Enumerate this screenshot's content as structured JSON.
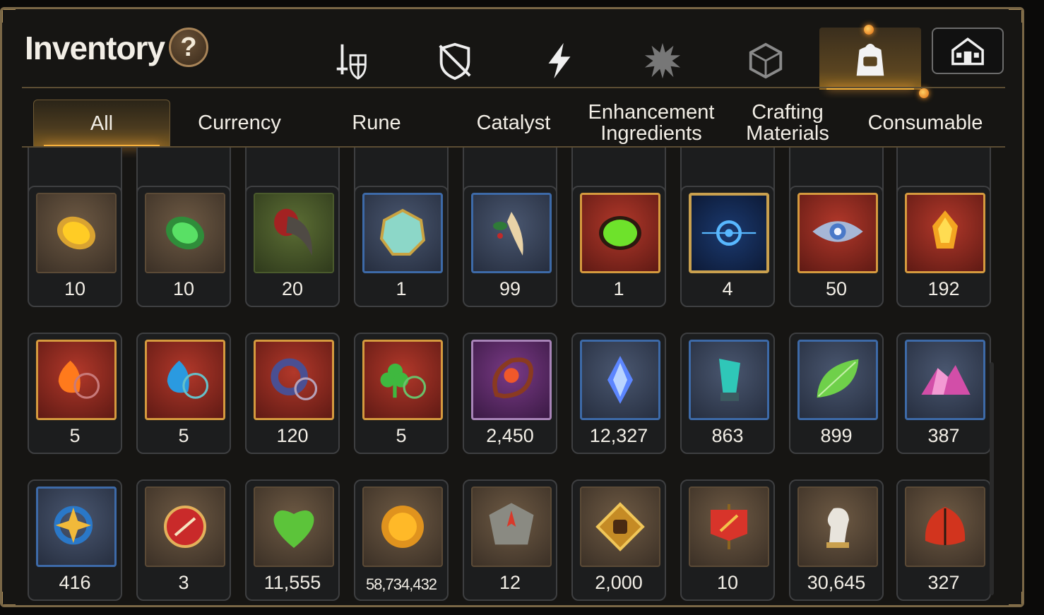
{
  "header": {
    "title": "Inventory",
    "help_label": "?"
  },
  "category_icons": [
    {
      "name": "equipment-icon",
      "active": false
    },
    {
      "name": "broken-shield-icon",
      "active": false
    },
    {
      "name": "lightning-icon",
      "active": false
    },
    {
      "name": "splatter-icon",
      "active": false
    },
    {
      "name": "cube-icon",
      "active": false
    },
    {
      "name": "backpack-icon",
      "active": true
    }
  ],
  "home_button": {
    "icon": "guild-hall-icon"
  },
  "tabs": [
    {
      "label": "All",
      "active": true
    },
    {
      "label": "Currency",
      "active": false
    },
    {
      "label": "Rune",
      "active": false
    },
    {
      "label": "Catalyst",
      "active": false
    },
    {
      "label": "Enhancement\nIngredients",
      "active": false
    },
    {
      "label": "Crafting\nMaterials",
      "active": false
    },
    {
      "label": "Consumable",
      "active": false
    }
  ],
  "rows": [
    [
      {
        "icon": "amber-stone-icon",
        "count": "10"
      },
      {
        "icon": "green-rune-stone-icon",
        "count": "10"
      },
      {
        "icon": "claw-icon",
        "count": "20"
      },
      {
        "icon": "prism-gem-icon",
        "count": "1"
      },
      {
        "icon": "root-herb-icon",
        "count": "99"
      },
      {
        "icon": "green-orb-icon",
        "count": "1"
      },
      {
        "icon": "blue-portal-icon",
        "count": "4"
      },
      {
        "icon": "eye-crest-icon",
        "count": "50"
      },
      {
        "icon": "flame-crystal-icon",
        "count": "192"
      }
    ],
    [
      {
        "icon": "fire-amulet-icon",
        "count": "5"
      },
      {
        "icon": "water-amulet-icon",
        "count": "5"
      },
      {
        "icon": "ring-amulet-icon",
        "count": "120"
      },
      {
        "icon": "clover-amulet-icon",
        "count": "5"
      },
      {
        "icon": "flower-ring-icon",
        "count": "2,450"
      },
      {
        "icon": "blue-crystal-icon",
        "count": "12,327"
      },
      {
        "icon": "teal-crystal-icon",
        "count": "863"
      },
      {
        "icon": "leaf-icon",
        "count": "899"
      },
      {
        "icon": "pink-ore-icon",
        "count": "387"
      }
    ],
    [
      {
        "icon": "star-amulet-icon",
        "count": "416"
      },
      {
        "icon": "seal-badge-icon",
        "count": "3"
      },
      {
        "icon": "heart-icon",
        "count": "11,555"
      },
      {
        "icon": "gold-coin-icon",
        "count": "58,734,432"
      },
      {
        "icon": "compass-stone-icon",
        "count": "12"
      },
      {
        "icon": "fist-emblem-icon",
        "count": "2,000"
      },
      {
        "icon": "war-banner-icon",
        "count": "10"
      },
      {
        "icon": "knight-piece-icon",
        "count": "30,645"
      },
      {
        "icon": "red-leaf-icon",
        "count": "327"
      }
    ]
  ],
  "colors": {
    "accent": "#f5b23a",
    "frame_gold": "#a88c5a",
    "text": "#f2eee6"
  }
}
